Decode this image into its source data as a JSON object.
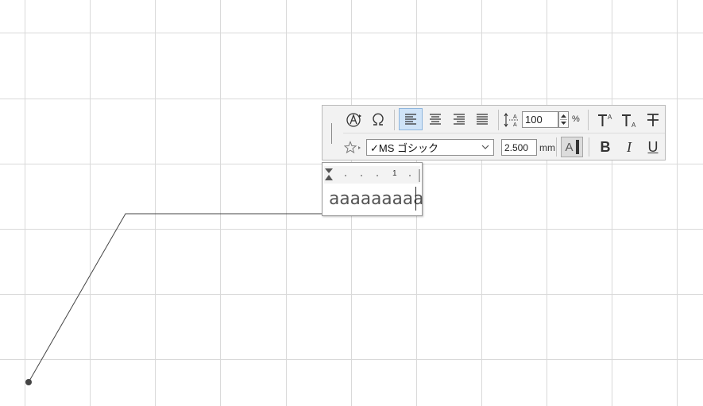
{
  "canvas": {
    "grid_color": "#d9d9d9",
    "line_color": "#444444"
  },
  "toolbar": {
    "line_spacing_value": "100",
    "line_spacing_unit": "%",
    "font_name": "✓MS ゴシック",
    "font_size_value": "2.500",
    "font_size_unit": "mm",
    "bold_label": "B",
    "italic_label": "I",
    "underline_label": "U",
    "color_label": "A",
    "accent_color": "#cfe3f7",
    "icons": [
      "text-style-icon",
      "special-character-icon",
      "align-left-icon",
      "align-center-icon",
      "align-right-icon",
      "justify-icon",
      "line-spacing-icon",
      "superscript-icon",
      "subscript-icon",
      "strikethrough-icon",
      "favorites-star-icon"
    ]
  },
  "text_editor": {
    "ruler_mark": "1",
    "text": "aaaaaaaaa"
  }
}
